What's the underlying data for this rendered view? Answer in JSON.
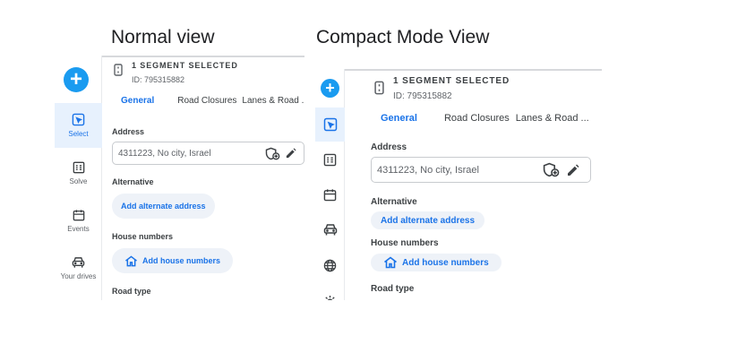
{
  "titles": {
    "normal": "Normal view",
    "compact": "Compact Mode View"
  },
  "colors": {
    "accent": "#1a73e8",
    "add_button": "#1a9bf0",
    "active_bg": "#e7f1fd",
    "pill_bg": "#eef2f8"
  },
  "segment": {
    "title": "1 SEGMENT SELECTED",
    "id": "ID: 795315882"
  },
  "normal": {
    "nav": [
      {
        "label": "Select",
        "icon": "select-icon",
        "active": true
      },
      {
        "label": "Solve",
        "icon": "solve-icon"
      },
      {
        "label": "Events",
        "icon": "events-icon"
      },
      {
        "label": "Your drives",
        "icon": "car-icon"
      }
    ],
    "tabs": [
      "General",
      "Road Closures",
      "Lanes & Road ."
    ]
  },
  "compact": {
    "nav_icons": [
      "select-icon",
      "solve-icon",
      "events-icon",
      "car-icon",
      "globe-icon"
    ],
    "tabs": [
      "General",
      "Road Closures",
      "Lanes & Road ..."
    ]
  },
  "form": {
    "address_label": "Address",
    "address_value": "4311223, No city, Israel",
    "alternative_label": "Alternative",
    "add_alternate": "Add alternate address",
    "house_numbers_label": "House numbers",
    "add_house_numbers": "Add house numbers",
    "road_type_label": "Road type"
  }
}
